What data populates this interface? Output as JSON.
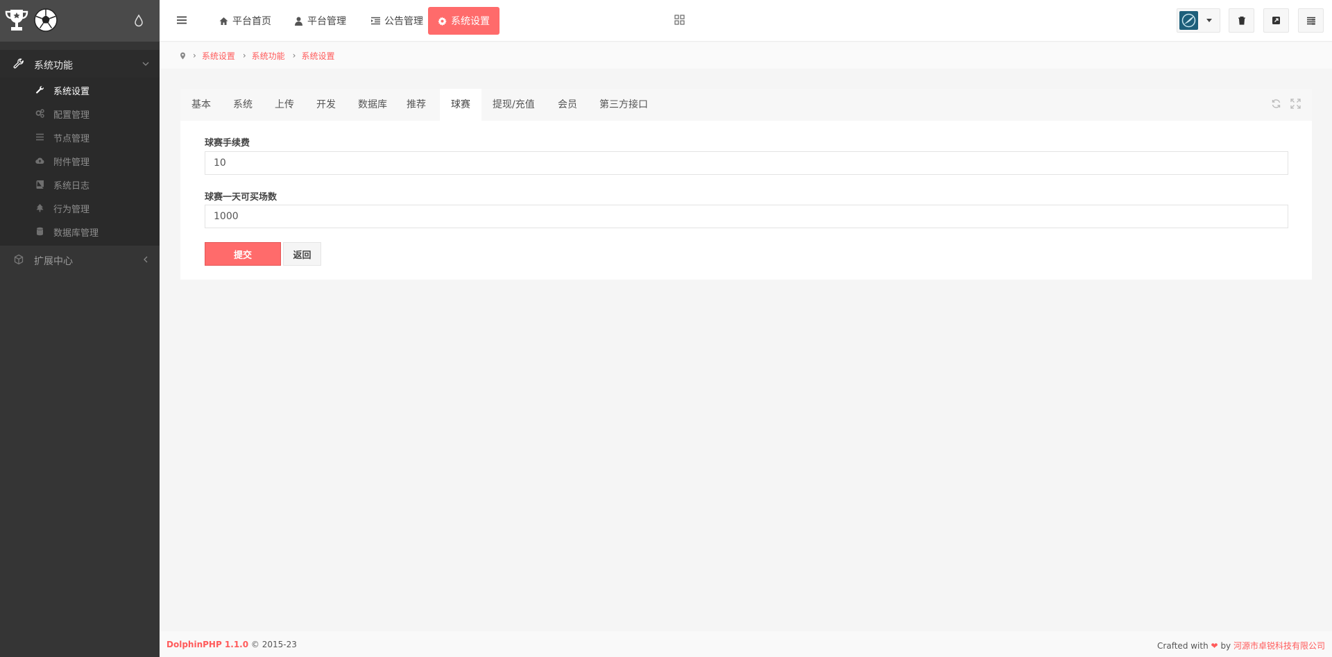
{
  "sidebar": {
    "groups": [
      {
        "label": "系统功能",
        "icon": "wrench-icon"
      },
      {
        "label": "扩展中心",
        "icon": "puzzle-icon"
      }
    ],
    "items": [
      {
        "label": "系统设置",
        "icon": "wrench-icon",
        "active": true
      },
      {
        "label": "配置管理",
        "icon": "gears-icon"
      },
      {
        "label": "节点管理",
        "icon": "list-icon"
      },
      {
        "label": "附件管理",
        "icon": "cloud-upload-icon"
      },
      {
        "label": "系统日志",
        "icon": "book-icon"
      },
      {
        "label": "行为管理",
        "icon": "tree-icon"
      },
      {
        "label": "数据库管理",
        "icon": "database-icon"
      }
    ]
  },
  "header": {
    "nav": [
      {
        "label": "平台首页",
        "icon": "home-icon"
      },
      {
        "label": "平台管理",
        "icon": "user-icon"
      },
      {
        "label": "公告管理",
        "icon": "indent-icon"
      },
      {
        "label": "系统设置",
        "icon": "gear-icon",
        "active": true
      }
    ]
  },
  "breadcrumb": [
    "系统设置",
    "系统功能",
    "系统设置"
  ],
  "tabs": [
    "基本",
    "系统",
    "上传",
    "开发",
    "数据库",
    "推荐",
    "球赛",
    "提现/充值",
    "会员",
    "第三方接口"
  ],
  "active_tab": "球赛",
  "form": {
    "fields": [
      {
        "label": "球赛手续费",
        "value": "10"
      },
      {
        "label": "球赛一天可买场数",
        "value": "1000"
      }
    ],
    "submit_label": "提交",
    "back_label": "返回"
  },
  "footer": {
    "brand": "DolphinPHP 1.1.0",
    "copyright": "© 2015-23",
    "crafted": "Crafted with",
    "by": "by",
    "company": "河源市卓锐科技有限公司"
  },
  "colors": {
    "accent": "#ff6b6b",
    "sidebar": "#353535"
  }
}
